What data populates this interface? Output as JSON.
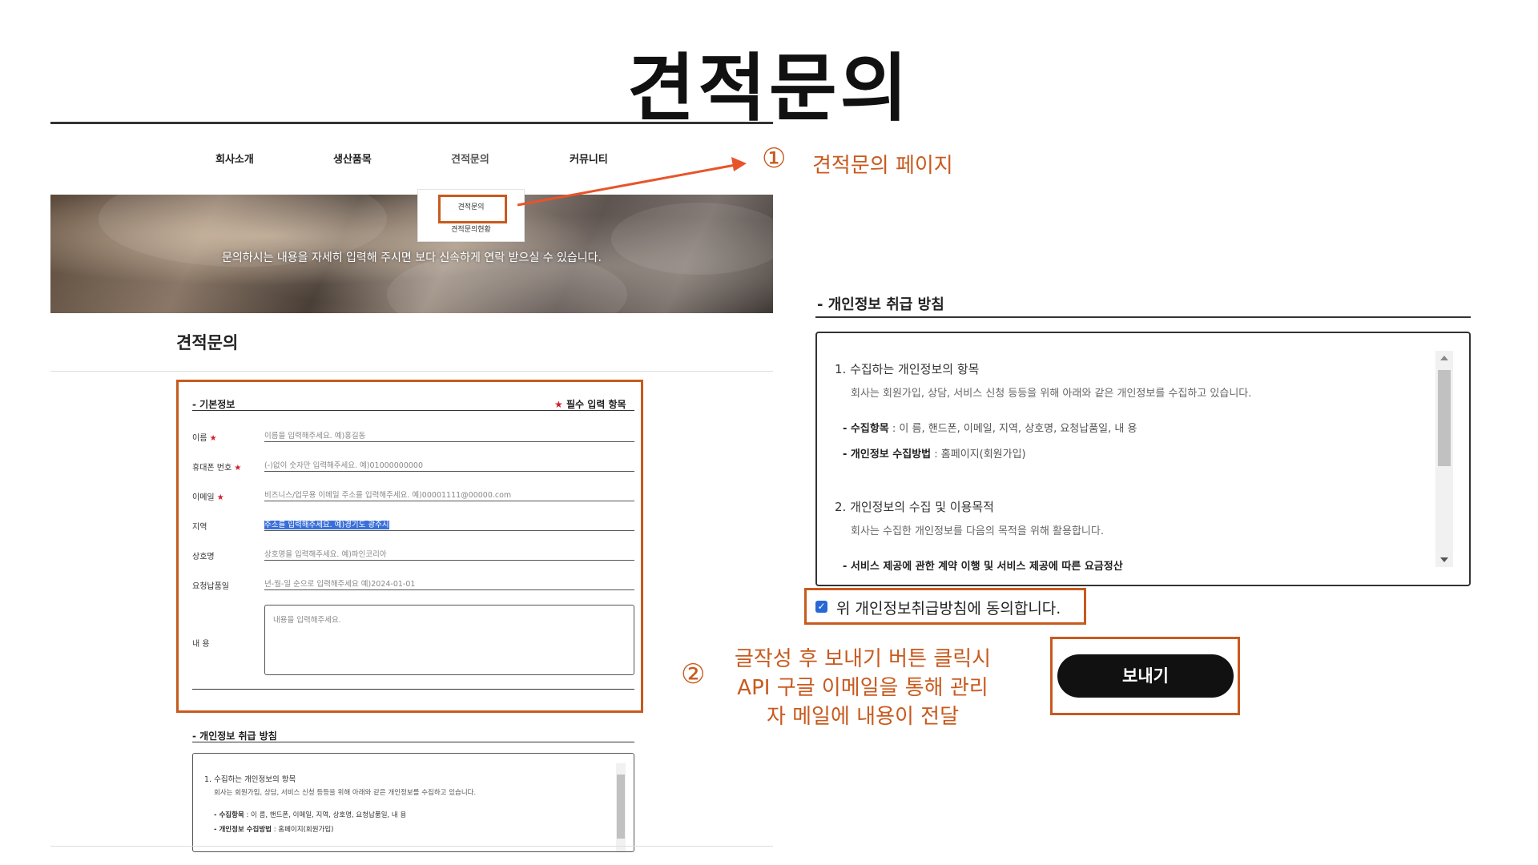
{
  "slide": {
    "title": "견적문의"
  },
  "site": {
    "nav": [
      "회사소개",
      "생산품목",
      "견적문의",
      "커뮤니티"
    ],
    "dropdown": [
      "견적문의",
      "견적문의현황"
    ],
    "hero_text": "문의하시는 내용을 자세히 입력해 주시면 보다 신속하게 연락 받으실 수 있습니다.",
    "section_title": "견적문의"
  },
  "form": {
    "section_label": "-  기본정보",
    "required_note": "필수 입력 항목",
    "star": "★",
    "fields": [
      {
        "label": "이름",
        "required": true,
        "placeholder": "이름을 입력해주세요. 예)홍길동"
      },
      {
        "label": "휴대폰 번호",
        "required": true,
        "placeholder": "(-)없이 숫자만 입력해주세요. 예)01000000000"
      },
      {
        "label": "이메일",
        "required": true,
        "placeholder": "비즈니스/업무용 이메일 주소를 입력해주세요. 예)00001111@00000.com"
      },
      {
        "label": "지역",
        "required": false,
        "placeholder": "주소를 입력해주세요. 예)경기도 광주시"
      },
      {
        "label": "상호명",
        "required": false,
        "placeholder": "상호명을 입력해주세요. 예)파인코리아"
      },
      {
        "label": "요청납품일",
        "required": false,
        "placeholder": "년-월-일 순으로 입력해주세요 예)2024-01-01"
      }
    ],
    "content_label": "내 용",
    "content_placeholder": "내용을 입력해주세요."
  },
  "privacy_small": {
    "label": "-  개인정보 취급 방침",
    "lines": [
      "1. 수집하는 개인정보의 항목",
      "회사는 회원가입, 상담, 서비스 신청 등등을 위해 아래와 같은 개인정보를 수집하고 있습니다.",
      "- 수집항목",
      " : 이 름, 핸드폰, 이메일, 지역, 상호명, 요청납품일, 내 용",
      "- 개인정보 수집방법",
      " : 홈페이지(회원가입)"
    ]
  },
  "privacy_large": {
    "label": "-  개인정보 취급 방침",
    "item1_title": "1. 수집하는 개인정보의 항목",
    "item1_desc": "회사는 회원가입, 상담, 서비스 신청 등등을 위해 아래와 같은 개인정보를 수집하고 있습니다.",
    "collect_items_label": "- 수집항목",
    "collect_items_value": " : 이 름, 핸드폰, 이메일, 지역, 상호명, 요청납품일, 내 용",
    "collect_method_label": "- 개인정보 수집방법",
    "collect_method_value": " : 홈페이지(회원가입)",
    "item2_title": "2. 개인정보의 수집 및 이용목적",
    "item2_desc": "회사는 수집한 개인정보를 다음의 목적을 위해 활용합니다.",
    "item2_bullet": "- 서비스 제공에 관한 계약 이행 및 서비스 제공에 따른 요금정산"
  },
  "agree": {
    "checked": true,
    "label": "위 개인정보취급방침에 동의합니다."
  },
  "send_button": "보내기",
  "annotations": {
    "one_mark": "①",
    "one_text": "견적문의 페이지",
    "two_mark": "②",
    "two_lines": [
      "글작성 후 보내기 버튼 클릭시",
      "API 구글 이메일을 통해 관리",
      "자 메일에 내용이 전달"
    ]
  },
  "colors": {
    "accent": "#c85a1e",
    "required_star": "#d0202a",
    "checkbox": "#2767d6",
    "button_bg": "#111111"
  }
}
